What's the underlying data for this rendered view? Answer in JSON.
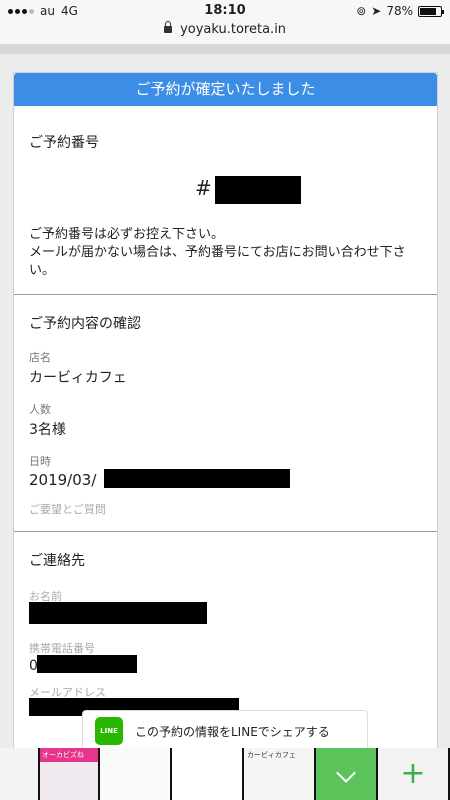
{
  "status_bar": {
    "carrier": "au",
    "network": "4G",
    "time": "18:10",
    "battery": "78%",
    "battery_level": 0.78
  },
  "url_bar": {
    "url": "yoyaku.toreta.in"
  },
  "card": {
    "header": "ご予約が確定いたしました",
    "reservation_number": {
      "title": "ご予約番号",
      "hash": "#",
      "notice_line1": "ご予約番号は必ずお控え下さい。",
      "notice_line2": "メールが届かない場合は、予約番号にてお店にお問い合わせ下さい。"
    },
    "details": {
      "title": "ご予約内容の確認",
      "store_label": "店名",
      "store_value": "カービィカフェ",
      "people_label": "人数",
      "people_value": "3名様",
      "datetime_label": "日時",
      "datetime_value": "2019/03/",
      "requests_label": "ご要望とご質問"
    },
    "contact": {
      "title": "ご連絡先",
      "name_label": "お名前",
      "phone_label": "携帯電話番号",
      "phone_value": "0",
      "email_label": "メールアドレス"
    }
  },
  "line_share": {
    "icon_text": "LINE",
    "label": "この予約の情報をLINEでシェアする"
  },
  "tabs": {
    "thumb2_banner": "オーカビズね",
    "thumb5_title": "カービィカフェ"
  },
  "colors": {
    "header_blue": "#3c8de6",
    "line_green": "#2ab700"
  }
}
